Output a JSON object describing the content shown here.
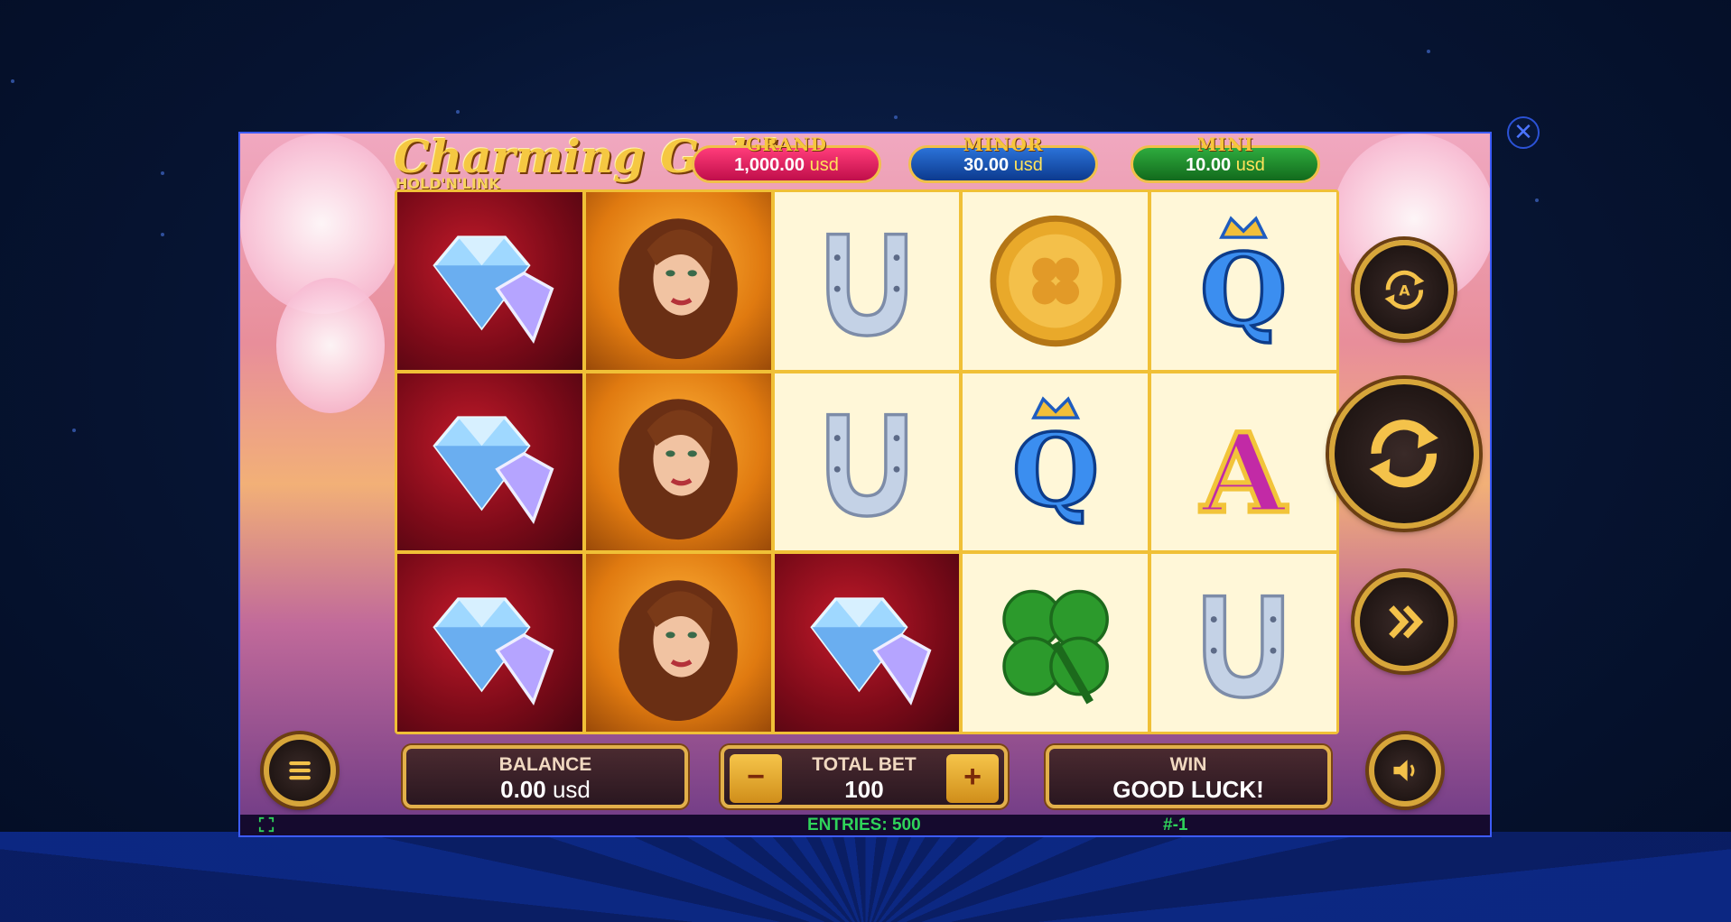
{
  "game": {
    "title": "Charming Gold",
    "subtitle": "HOLD'N'LINK"
  },
  "jackpots": [
    {
      "label": "GRAND",
      "amount": "1,000.00",
      "unit": "usd",
      "color": "#e0195e"
    },
    {
      "label": "MINOR",
      "amount": "30.00",
      "unit": "usd",
      "color": "#1756b8"
    },
    {
      "label": "MINI",
      "amount": "10.00",
      "unit": "usd",
      "color": "#1f8a2e"
    }
  ],
  "reels": [
    [
      "diamond",
      "woman",
      "horseshoe",
      "coin",
      "queen"
    ],
    [
      "diamond",
      "woman",
      "horseshoe",
      "queen",
      "ace"
    ],
    [
      "diamond",
      "woman",
      "diamond",
      "clover",
      "horseshoe"
    ]
  ],
  "controls": {
    "autoplay_icon": "autoplay-icon",
    "spin_icon": "spin-icon",
    "turbo_icon": "turbo-icon",
    "menu_icon": "menu-icon",
    "sound_icon": "sound-icon",
    "close_glyph": "✕"
  },
  "balance": {
    "label": "BALANCE",
    "value": "0.00",
    "unit": "usd"
  },
  "bet": {
    "label": "TOTAL BET",
    "value": "100",
    "minus": "−",
    "plus": "+"
  },
  "win": {
    "label": "WIN",
    "value": "GOOD LUCK!"
  },
  "status": {
    "entries": "ENTRIES: 500",
    "round": "#-1"
  }
}
